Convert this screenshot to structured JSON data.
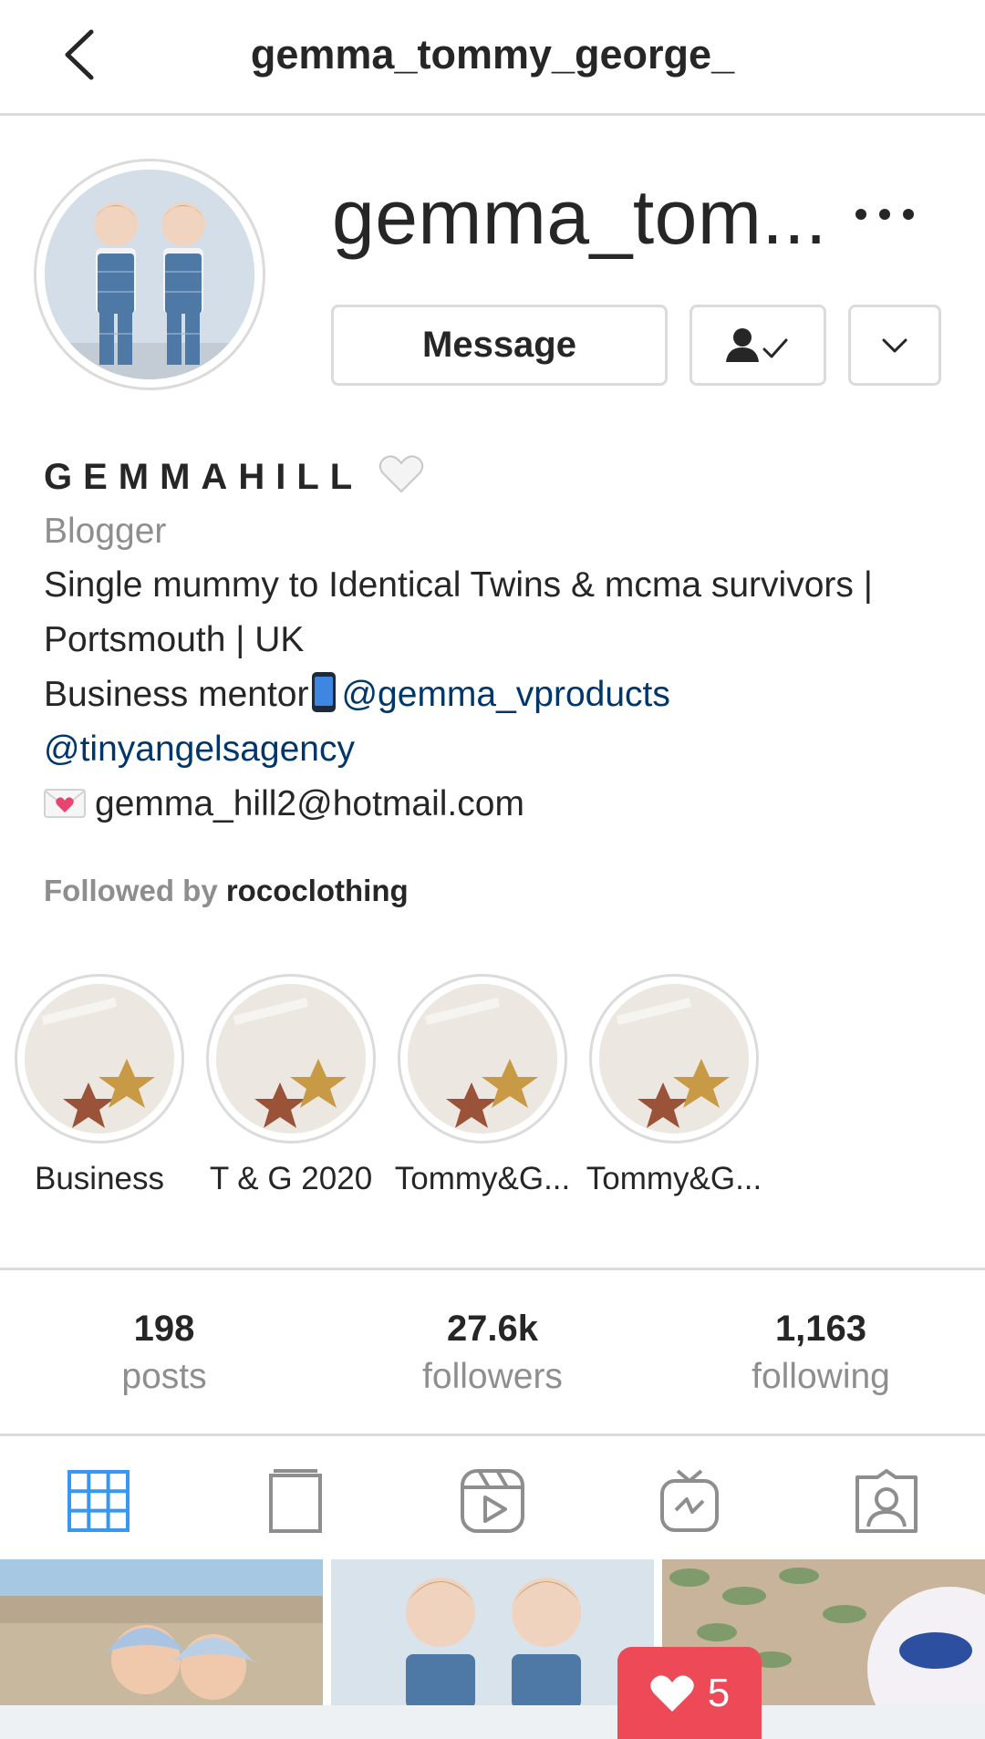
{
  "header": {
    "title": "gemma_tommy_george_"
  },
  "profile": {
    "username_display": "gemma_tom...",
    "buttons": {
      "message": "Message"
    }
  },
  "bio": {
    "name": "GEMMAHILL",
    "name_emoji": "white-heart",
    "category": "Blogger",
    "line1": "Single mummy to Identical Twins & mcma survivors |",
    "line2": "Portsmouth | UK",
    "line3_text": "Business mentor",
    "line3_emoji": "mobile-phone",
    "line3_link": "@gemma_vproducts",
    "line4_link": "@tinyangelsagency",
    "email_emoji": "love-letter",
    "email": "gemma_hill2@hotmail.com",
    "followed_by_label": "Followed by",
    "followed_by_user": "rococlothing"
  },
  "highlights": [
    {
      "label": "Business"
    },
    {
      "label": "T & G 2020"
    },
    {
      "label": "Tommy&G..."
    },
    {
      "label": "Tommy&G..."
    }
  ],
  "stats": {
    "posts": {
      "value": "198",
      "label": "posts"
    },
    "followers": {
      "value": "27.6k",
      "label": "followers"
    },
    "following": {
      "value": "1,163",
      "label": "following"
    }
  },
  "tabs": [
    {
      "icon": "grid-icon",
      "active": true
    },
    {
      "icon": "guide-icon",
      "active": false
    },
    {
      "icon": "reels-icon",
      "active": false
    },
    {
      "icon": "igtv-icon",
      "active": false
    },
    {
      "icon": "tagged-icon",
      "active": false
    }
  ],
  "notification": {
    "icon": "heart-icon",
    "count": "5"
  },
  "colors": {
    "link": "#00376b",
    "active_tab": "#3897f0",
    "secondary_text": "#8e8e8e",
    "divider": "#dbdbdb",
    "notification": "#ed4956"
  }
}
